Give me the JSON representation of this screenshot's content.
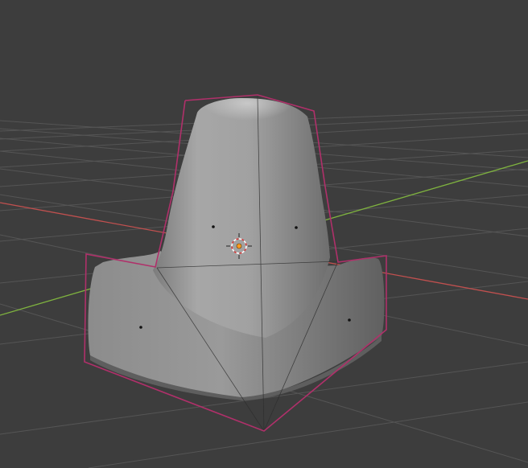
{
  "viewport": {
    "background": "#3d3d3d",
    "grid_color": "#555555",
    "x_axis_color": "#c0504f",
    "y_axis_color": "#7fb33f",
    "selection_outline_color": "#b0306a",
    "object_color": "#9e9e9e",
    "origin_color": "#ff9a1f",
    "cursor": "3d-cursor-icon"
  }
}
